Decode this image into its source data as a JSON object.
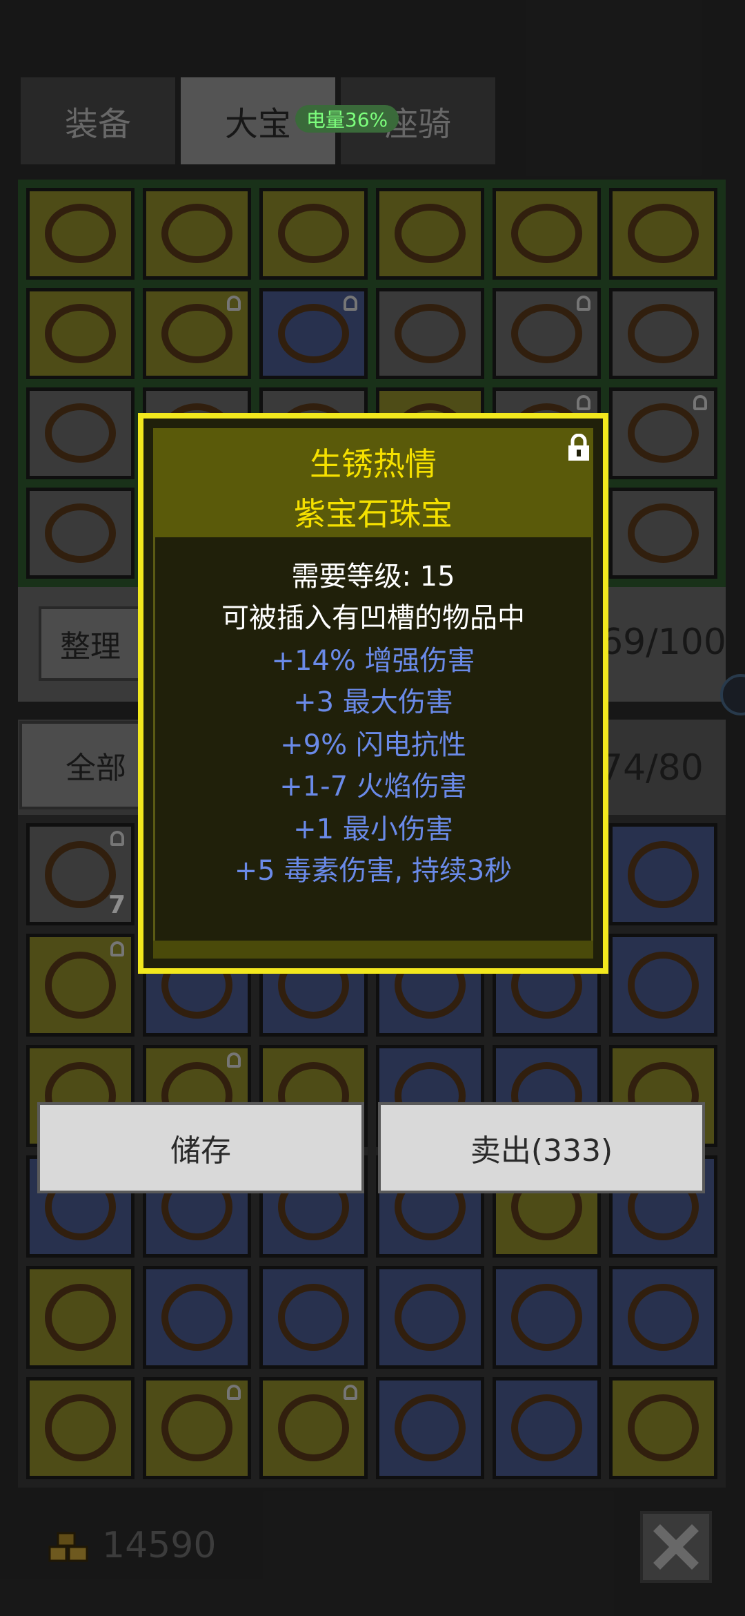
{
  "tabs": [
    {
      "label": "装备",
      "active": false
    },
    {
      "label": "大宝",
      "active": true
    },
    {
      "label": "座骑",
      "active": false
    }
  ],
  "battery_label": "电量36%",
  "inventory_top": {
    "sort_label": "整理",
    "capacity": "69/100",
    "colors": [
      "y",
      "y",
      "y",
      "y",
      "y",
      "y",
      "y",
      "y",
      "b",
      "g",
      "g",
      "g",
      "g",
      "g",
      "g",
      "y",
      "g",
      "g",
      "g",
      "g",
      "y",
      "g",
      "g",
      "g"
    ]
  },
  "inventory_bottom": {
    "filter_label": "全部",
    "capacity": "74/80",
    "first_slot_count": "7",
    "colors": [
      "g",
      "b",
      "b",
      "b",
      "b",
      "b",
      "y",
      "b",
      "b",
      "b",
      "b",
      "b",
      "y",
      "y",
      "y",
      "b",
      "b",
      "y",
      "b",
      "b",
      "b",
      "b",
      "y",
      "b",
      "y",
      "b",
      "b",
      "b",
      "b",
      "b",
      "y",
      "y",
      "y",
      "b",
      "b",
      "y"
    ]
  },
  "popup": {
    "name": "生锈热情",
    "type": "紫宝石珠宝",
    "requirement": "需要等级: 15",
    "socket_note": "可被插入有凹槽的物品中",
    "stats": [
      "+14% 增强伤害",
      "+3 最大伤害",
      "+9% 闪电抗性",
      "+1-7 火焰伤害",
      "+1 最小伤害",
      "+5 毒素伤害, 持续3秒"
    ],
    "colors": {
      "border": "#f2e81e",
      "title": "#f5e000",
      "stat": "#6a8ae8"
    }
  },
  "actions": {
    "store_label": "储存",
    "sell_label": "卖出(333)"
  },
  "gold": "14590",
  "icons": [
    "gold-icon",
    "close-icon",
    "lock-icon"
  ]
}
